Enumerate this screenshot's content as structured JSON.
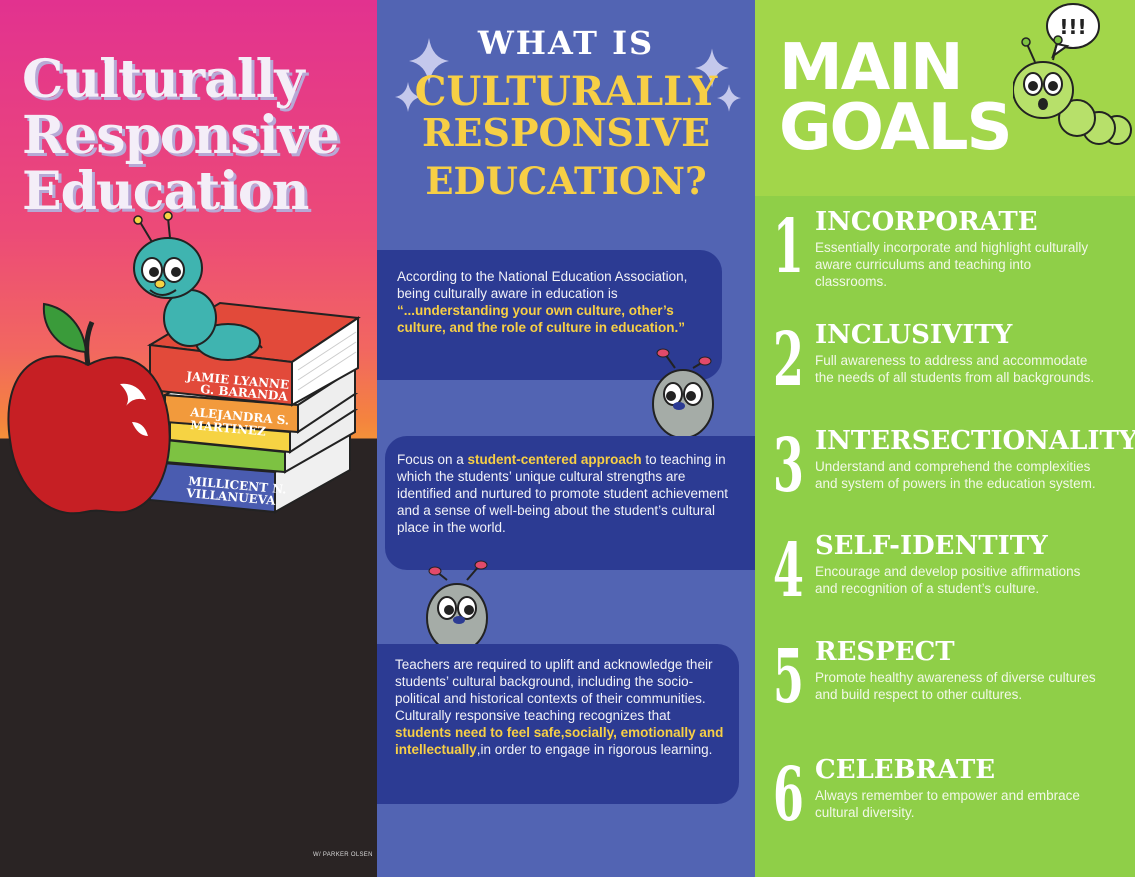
{
  "left": {
    "title_lines": [
      "Culturally",
      "Responsive",
      "Education"
    ],
    "books": [
      "JAMIE LYANNE",
      "G. BARANDA",
      "ALEJANDRA S.",
      "MARTINEZ",
      "MILLICENT N.",
      "VILLANUEVA"
    ],
    "credit": "W/ PARKER OLSEN"
  },
  "middle": {
    "title_line1": "WHAT IS",
    "title_line2": "CULTURALLY",
    "title_line3": "RESPONSIVE",
    "title_line4": "EDUCATION?",
    "bubble1": {
      "text": "According to the National Education Association, being culturally aware in education is ",
      "highlight": "“...understanding your own culture, other’s culture, and the role of culture in education.”"
    },
    "bubble2": {
      "before": "Focus on a ",
      "highlight": "student-centered approach",
      "after": " to teaching in which the students’ unique cultural strengths are identified and nurtured to promote student achievement and a sense of well-being about the student’s cultural place in the world."
    },
    "bubble3": {
      "before": "Teachers are required to uplift and acknowledge their students’ cultural background, including the socio-political and historical contexts of their communities. Culturally responsive teaching recognizes that ",
      "highlight": "students need to feel safe,socially, emotionally and intellectually",
      "after": ",in order to engage in rigorous learning."
    }
  },
  "right": {
    "title_line1": "MAIN",
    "title_line2": "GOALS",
    "speech": "!!!",
    "goals": [
      {
        "num": "1",
        "title": "INCORPORATE",
        "desc": "Essentially incorporate and highlight culturally aware curriculums and teaching into classrooms."
      },
      {
        "num": "2",
        "title": "INCLUSIVITY",
        "desc": "Full awareness to address and accommodate the needs of all students from all backgrounds."
      },
      {
        "num": "3",
        "title": "INTERSECTIONALITY",
        "desc": "Understand and comprehend the complexities and system of powers in the education system."
      },
      {
        "num": "4",
        "title": "SELF-IDENTITY",
        "desc": "Encourage and develop positive affirmations and recognition of a student’s culture."
      },
      {
        "num": "5",
        "title": "RESPECT",
        "desc": "Promote healthy awareness of diverse cultures and build respect to other cultures."
      },
      {
        "num": "6",
        "title": "CELEBRATE",
        "desc": "Always remember to empower and embrace cultural diversity."
      }
    ]
  },
  "colors": {
    "pink": "#e2328f",
    "orange": "#f4913a",
    "dark": "#2a2424",
    "blue": "#5264b3",
    "navy": "#2c3b93",
    "yellow": "#f7cf45",
    "green": "#8fcf48"
  }
}
